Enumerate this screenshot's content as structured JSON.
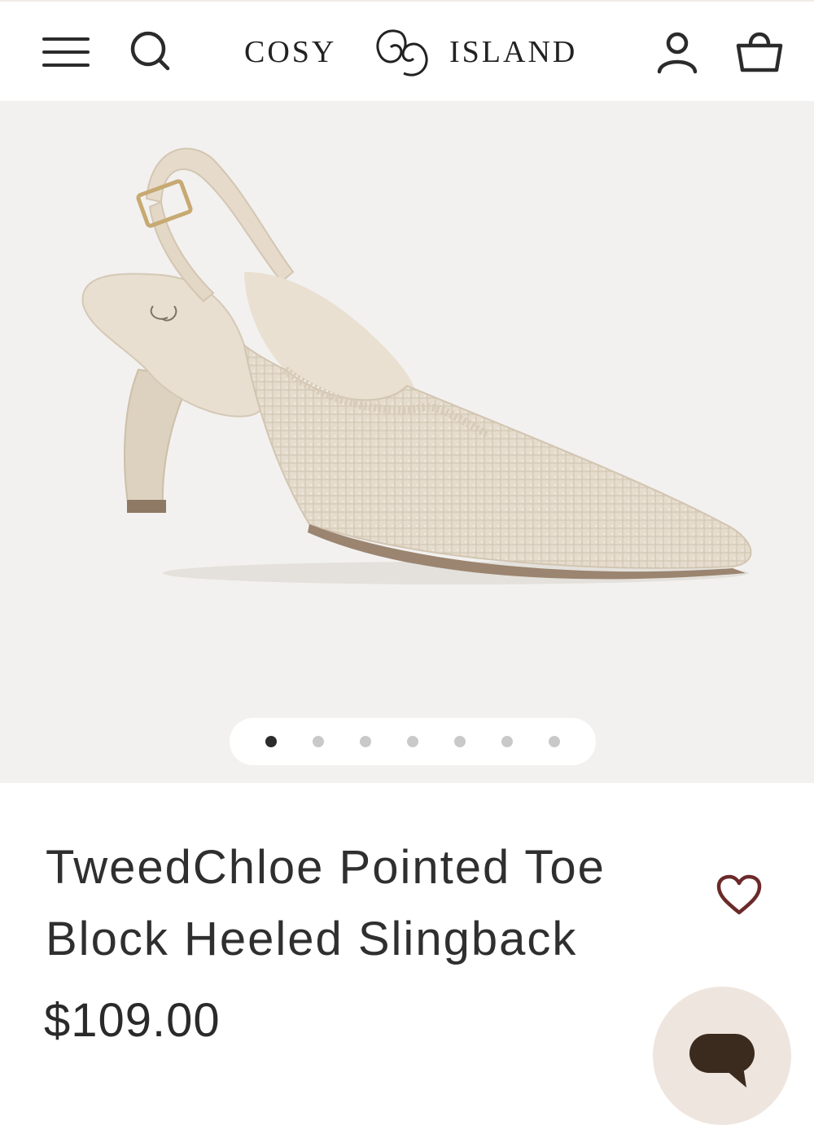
{
  "header": {
    "brand_left": "COSY",
    "brand_right": "ISLAND",
    "icons": [
      "menu-icon",
      "search-icon",
      "account-icon",
      "cart-icon"
    ]
  },
  "gallery": {
    "slide_count": 7,
    "active_index": 0
  },
  "product": {
    "title": "TweedChloe Pointed Toe Block Heeled Slingback",
    "price": "$109.00"
  },
  "colors": {
    "hero_background": "#f2f1ef",
    "text": "#2f2f2f",
    "wishlist": "#6b2a2a",
    "chat_button": "#eee5de",
    "chat_icon": "#3b2a1e"
  }
}
